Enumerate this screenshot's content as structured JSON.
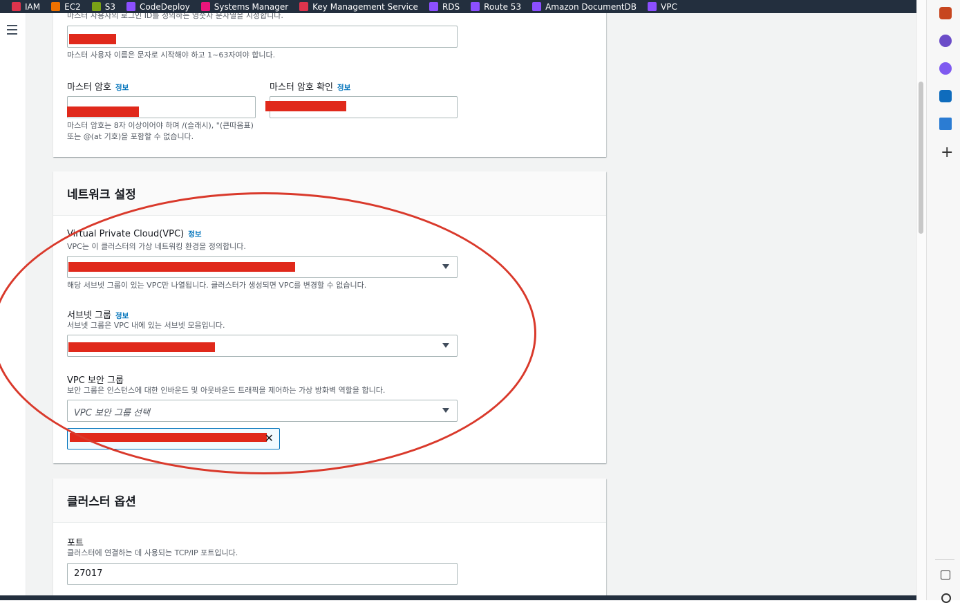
{
  "topbar": {
    "services": [
      {
        "label": "IAM",
        "color": "#dd344c",
        "icon": "iam-icon"
      },
      {
        "label": "EC2",
        "color": "#ed7100",
        "icon": "ec2-icon"
      },
      {
        "label": "S3",
        "color": "#7aa116",
        "icon": "s3-icon"
      },
      {
        "label": "CodeDeploy",
        "color": "#8c4fff",
        "icon": "codedeploy-icon"
      },
      {
        "label": "Systems Manager",
        "color": "#e7157b",
        "icon": "systems-manager-icon"
      },
      {
        "label": "Key Management Service",
        "color": "#dd344c",
        "icon": "kms-icon"
      },
      {
        "label": "RDS",
        "color": "#8c4fff",
        "icon": "rds-icon"
      },
      {
        "label": "Route 53",
        "color": "#8c4fff",
        "icon": "route53-icon"
      },
      {
        "label": "Amazon DocumentDB",
        "color": "#8c4fff",
        "icon": "documentdb-icon"
      },
      {
        "label": "VPC",
        "color": "#8c4fff",
        "icon": "vpc-icon"
      }
    ]
  },
  "auth_panel": {
    "username_desc_top": "마스터 사용자의 로그인 ID를 정의하는 영숫자 문자열을 지정합니다.",
    "username_hint": "마스터 사용자 이름은 문자로 시작해야 하고 1~63자여야 합니다.",
    "password_label": "마스터 암호",
    "password_confirm_label": "마스터 암호 확인",
    "info_label": "정보",
    "password_hint_line1": "마스터 암호는 8자 이상이어야 하며 /(슬래시), \"(큰따옴표)",
    "password_hint_line2": "또는 @(at 기호)을 포함할 수 없습니다."
  },
  "network_panel": {
    "title": "네트워크 설정",
    "vpc_label": "Virtual Private Cloud(VPC)",
    "vpc_desc": "VPC는 이 클러스터의 가상 네트워킹 환경을 정의합니다.",
    "vpc_hint": "해당 서브넷 그룹이 있는 VPC만 나열됩니다. 클러스터가 생성되면 VPC를 변경할 수 없습니다.",
    "subnet_label": "서브넷 그룹",
    "subnet_desc": "서브넷 그룹은 VPC 내에 있는 서브넷 모음입니다.",
    "sg_label": "VPC 보안 그룹",
    "sg_desc": "보안 그룹은 인스턴스에 대한 인바운드 및 아웃바운드 트래픽을 제어하는 가상 방화벽 역할을 합니다.",
    "sg_placeholder": "VPC 보안 그룹 선택",
    "info_label": "정보"
  },
  "cluster_panel": {
    "title": "클러스터 옵션",
    "port_label": "포트",
    "port_desc": "클러스터에 연결하는 데 사용되는 TCP/IP 포트입니다.",
    "port_value": "27017"
  },
  "colors": {
    "redaction": "#e0291b",
    "annotation_oval": "#d9392b",
    "link": "#0073bb"
  }
}
